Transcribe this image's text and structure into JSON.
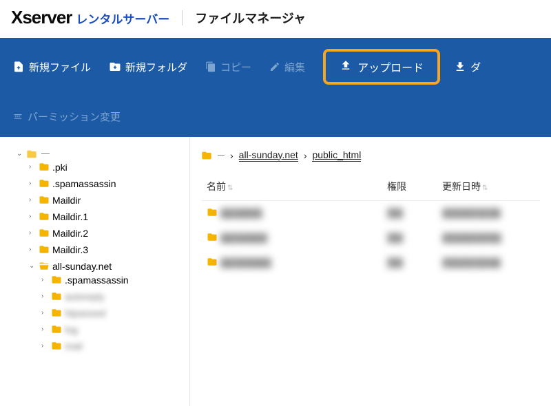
{
  "header": {
    "brand_main": "Xserver",
    "brand_sub": "レンタルサーバー",
    "app_title": "ファイルマネージャ"
  },
  "toolbar": {
    "new_file": "新規ファイル",
    "new_folder": "新規フォルダ",
    "copy": "コピー",
    "edit": "編集",
    "upload": "アップロード",
    "download": "ダ",
    "permission": "パーミッション変更"
  },
  "sidebar": {
    "root_children": [
      {
        "label": ".pki",
        "expanded": false
      },
      {
        "label": ".spamassassin",
        "expanded": false
      },
      {
        "label": "Maildir",
        "expanded": false
      },
      {
        "label": "Maildir.1",
        "expanded": false
      },
      {
        "label": "Maildir.2",
        "expanded": false
      },
      {
        "label": "Maildir.3",
        "expanded": false
      },
      {
        "label": "all-sunday.net",
        "expanded": true,
        "children": [
          {
            "label": ".spamassassin",
            "expanded": false,
            "blurred": false
          },
          {
            "label": "autoreply",
            "expanded": false,
            "blurred": true
          },
          {
            "label": "htpasswd",
            "expanded": false,
            "blurred": true
          },
          {
            "label": "log",
            "expanded": false,
            "blurred": true
          },
          {
            "label": "mail",
            "expanded": false,
            "blurred": true
          }
        ]
      }
    ]
  },
  "breadcrumb": {
    "seg1": "all-sunday.net",
    "seg2": "public_html"
  },
  "table": {
    "col_name": "名前",
    "col_perm": "権限",
    "col_date": "更新日時",
    "rows": [
      {
        "name": "wp-admin",
        "perm": "755",
        "date": "4/12/23 11:38"
      },
      {
        "name": "wp-content",
        "perm": "755",
        "date": "4/12/23 07:01"
      },
      {
        "name": "wp-includes",
        "perm": "755",
        "date": "7/11/12 10:48"
      }
    ]
  }
}
